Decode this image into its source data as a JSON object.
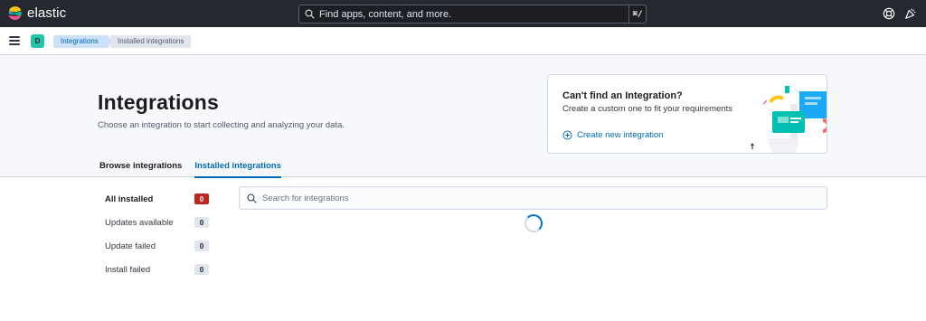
{
  "header": {
    "brand": "elastic",
    "search_placeholder": "Find apps, content, and more.",
    "search_shortcut": "⌘/",
    "icons": [
      "help-icon",
      "newsfeed-icon"
    ]
  },
  "subbar": {
    "space_initial": "D",
    "breadcrumbs": [
      "Integrations",
      "Installed integrations"
    ]
  },
  "page": {
    "title": "Integrations",
    "description": "Choose an integration to start collecting and analyzing your data.",
    "tabs": [
      {
        "label": "Browse integrations",
        "active": false
      },
      {
        "label": "Installed integrations",
        "active": true
      }
    ]
  },
  "promo": {
    "title": "Can't find an Integration?",
    "subtitle": "Create a custom one to fit your requirements",
    "link": "Create new integration"
  },
  "filters": [
    {
      "label": "All installed",
      "count": "0",
      "active": true
    },
    {
      "label": "Updates available",
      "count": "0",
      "active": false
    },
    {
      "label": "Update failed",
      "count": "0",
      "active": false
    },
    {
      "label": "Install failed",
      "count": "0",
      "active": false
    }
  ],
  "search": {
    "placeholder": "Search for integrations",
    "value": ""
  },
  "colors": {
    "header_bg": "#25282f",
    "accent": "#006bb8",
    "danger_badge": "#bd271e",
    "space_avatar": "#20c4a8"
  }
}
